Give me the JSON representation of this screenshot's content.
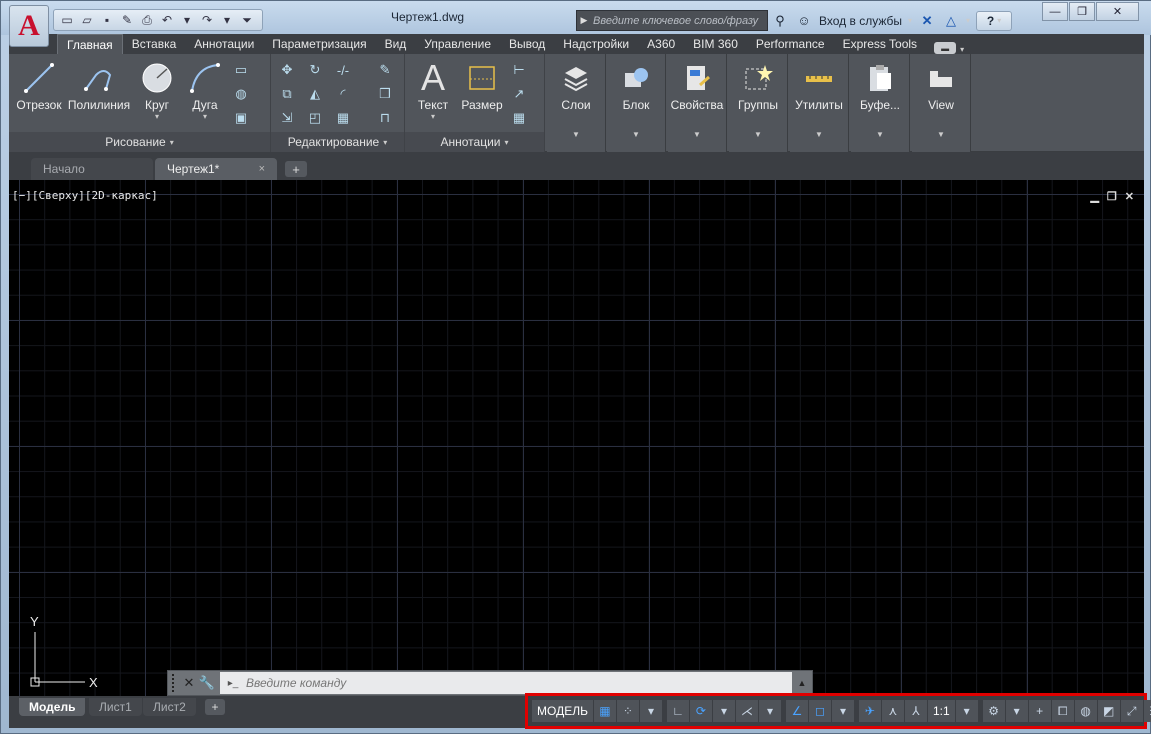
{
  "window": {
    "title": "Чертеж1.dwg",
    "logo": "A"
  },
  "qat": {
    "icons": [
      "new-icon",
      "open-icon",
      "save-icon",
      "saveas-icon",
      "print-icon",
      "undo-icon",
      "redo-icon",
      "customize-icon"
    ]
  },
  "search": {
    "placeholder": "Введите ключевое слово/фразу"
  },
  "signin": {
    "label": "Вход в службы"
  },
  "help": {
    "glyph": "?"
  },
  "ribbon_tabs": [
    "Главная",
    "Вставка",
    "Аннотации",
    "Параметризация",
    "Вид",
    "Управление",
    "Вывод",
    "Надстройки",
    "A360",
    "BIM 360",
    "Performance",
    "Express Tools"
  ],
  "panels": {
    "draw": {
      "title": "Рисование",
      "buttons": [
        "Отрезок",
        "Полилиния",
        "Круг",
        "Дуга"
      ]
    },
    "modify": {
      "title": "Редактирование"
    },
    "annotation": {
      "title": "Аннотации",
      "buttons": [
        "Текст",
        "Размер"
      ]
    },
    "stacked": [
      "Слои",
      "Блок",
      "Свойства",
      "Группы",
      "Утилиты",
      "Буфе...",
      "View"
    ]
  },
  "file_tabs": {
    "start": "Начало",
    "current": "Чертеж1*",
    "close": "×",
    "add": "+"
  },
  "viewport": {
    "label": "[−][Сверху][2D-каркас]"
  },
  "ucs": {
    "x": "X",
    "y": "Y"
  },
  "command": {
    "placeholder": "Введите команду",
    "prompt": "▸_"
  },
  "layout_tabs": {
    "model": "Модель",
    "sheet1": "Лист1",
    "sheet2": "Лист2",
    "add": "+"
  },
  "status": {
    "model": "МОДЕЛЬ",
    "scale": "1:1"
  },
  "colors": {
    "accent": "#4aa3ff",
    "highlight": "#e00000",
    "ribbon_bg": "#51555b",
    "canvas": "#000000"
  }
}
